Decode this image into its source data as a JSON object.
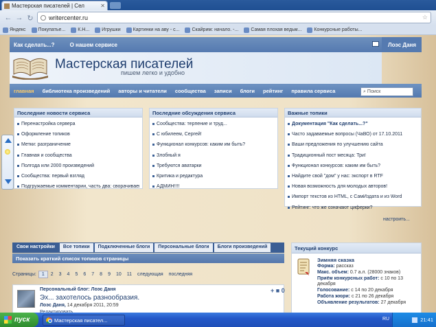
{
  "browser": {
    "tab_title": "Мастерская писателей | Сел",
    "url": "writercenter.ru",
    "bookmarks": [
      "Яндекс",
      "Покупатье...",
      "К.Н...",
      "Игрушки",
      "Картинки на аву - с...",
      "Скайрим: начало. -...",
      "Самая плохая ведьм...",
      "Конкурсные работы..."
    ]
  },
  "site": {
    "topnav": {
      "how_label": "Как сделать...?",
      "about_label": "О нашем сервисе",
      "user": "Лоэс Даня"
    },
    "title": "Мастерская писателей",
    "tagline": "пишем легко и удобно",
    "mainnav": [
      "главная",
      "библиотека произведений",
      "авторы и читатели",
      "сообщества",
      "записи",
      "блоги",
      "рейтинг",
      "правила сервиса"
    ],
    "search_placeholder": "Поиск"
  },
  "columns": [
    {
      "title": "Последние новости сервиса",
      "items": [
        "Перенастройка сервера",
        "Оформление топиков",
        "Метки: разграничение",
        "Главная и сообщества",
        "Полгода или 2000 произведений",
        "Сообщества: первый взгляд",
        "Подгружаемые комментарии, часть два: сворачиваем"
      ]
    },
    {
      "title": "Последние обсуждения сервиса",
      "items": [
        "Сообщества: терпение и труд...",
        "С юбилеем, Сергей!",
        "Функционал конкурсов: каким им быть?",
        "Злобный я",
        "Требуются аватарки",
        "Критика и редактура",
        "АДМИН!!!!"
      ]
    },
    {
      "title": "Важные топики",
      "items": [
        "Документация \"Как сделать...?\"",
        "Часто задаваемые вопросы (ЧаВО) от 17.10.2011",
        "Ваши предложения по улучшению сайта",
        "Традиционный пост месяца: Три!",
        "Функционал конкурсов: каким им быть?",
        "Найдите свой \"дом\" у нас: экспорт в RTF",
        "Новая возможность для молодых авторов!",
        "Импорт текстов из HTML, с СамИздата и из Word",
        "Рейтинг: что же означают циферки?"
      ]
    }
  ],
  "configure_label": "настроить...",
  "tabs": [
    "Свои настройки",
    "Все топики",
    "Подключенные блоги",
    "Персональные блоги",
    "Блоги произведений"
  ],
  "brief_label": "Показать краткий список топиков страницы",
  "pager": {
    "label": "Страницы:",
    "pages": [
      "1",
      "2",
      "3",
      "4",
      "5",
      "6",
      "7",
      "8",
      "9",
      "10",
      "11"
    ],
    "next": "следующая",
    "last": "последняя"
  },
  "post": {
    "blog": "Персональный блог: Лоэс Даня",
    "title": "Эх... захотелось разнообразия.",
    "author": "Лоэс Даня,",
    "date": "14 декабря 2011, 20:59",
    "edit": "Редактировать",
    "controls": "+ ■ 0"
  },
  "contest": {
    "header": "Текущий конкурс",
    "name": "Зимняя сказка",
    "rows": [
      {
        "k": "Форма:",
        "v": "рассказ"
      },
      {
        "k": "Макс. объем:",
        "v": "0.7 а.л. (28000 знаков)"
      },
      {
        "k": "Приём конкурсных работ:",
        "v": "с 10 по 13"
      },
      {
        "k": "",
        "v": "декабря"
      },
      {
        "k": "Голосование:",
        "v": "с 14 по 20 декабря"
      },
      {
        "k": "Работа жюри:",
        "v": "с 21 по 26 декабря"
      },
      {
        "k": "Объявление результатов:",
        "v": "27 декабря"
      }
    ]
  },
  "taskbar": {
    "start": "пуск",
    "item": "Мастерская писател...",
    "lang": "RU",
    "time": "21:41"
  },
  "colors": {
    "nav": "#557ab0",
    "title": "#1e3d6e",
    "taskbar": "#2458c8",
    "start": "#2e8c2e"
  }
}
